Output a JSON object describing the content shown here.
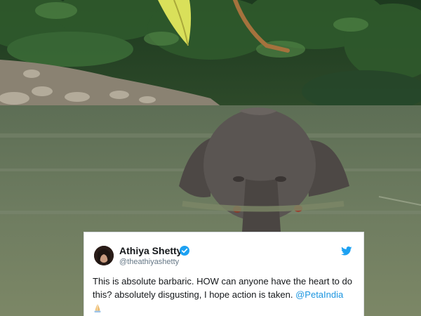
{
  "tweet": {
    "display_name": "Athiya Shetty",
    "handle": "@theathiyashetty",
    "text": "This is absolute barbaric. HOW can anyone have the heart to do this? absolutely disgusting, I hope action is taken.",
    "mention": "@PetaIndia",
    "emoji": "folded-hands-icon",
    "link_color": "#1b95e0",
    "verified_color": "#1da1f2"
  }
}
